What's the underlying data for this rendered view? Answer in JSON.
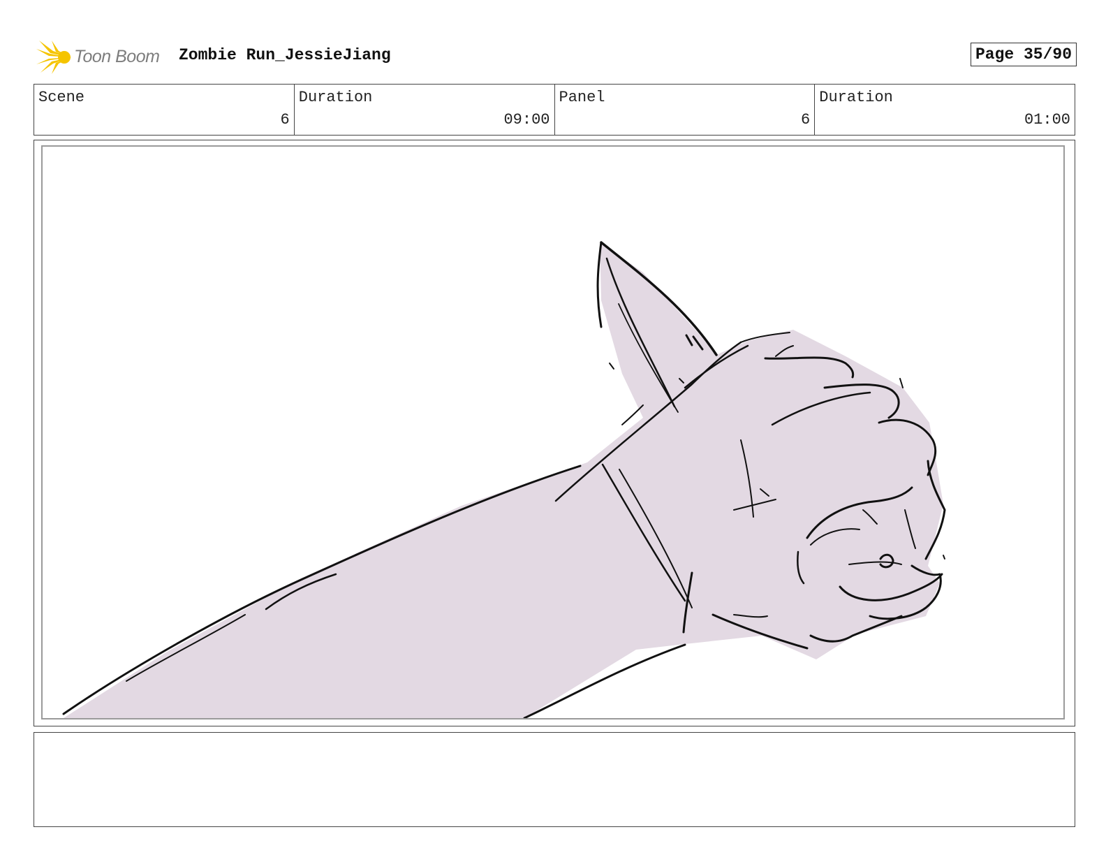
{
  "header": {
    "logo_text": "Toon Boom",
    "project_title": "Zombie Run_JessieJiang",
    "page_indicator": "Page 35/90"
  },
  "info": {
    "scene_label": "Scene",
    "scene_value": "6",
    "scene_duration_label": "Duration",
    "scene_duration_value": "09:00",
    "panel_label": "Panel",
    "panel_value": "6",
    "panel_duration_label": "Duration",
    "panel_duration_value": "01:00"
  },
  "colors": {
    "logo_accent": "#f5c400",
    "sketch_fill": "#e3d9e3",
    "sketch_stroke": "#111111"
  },
  "notes": {
    "text": ""
  }
}
